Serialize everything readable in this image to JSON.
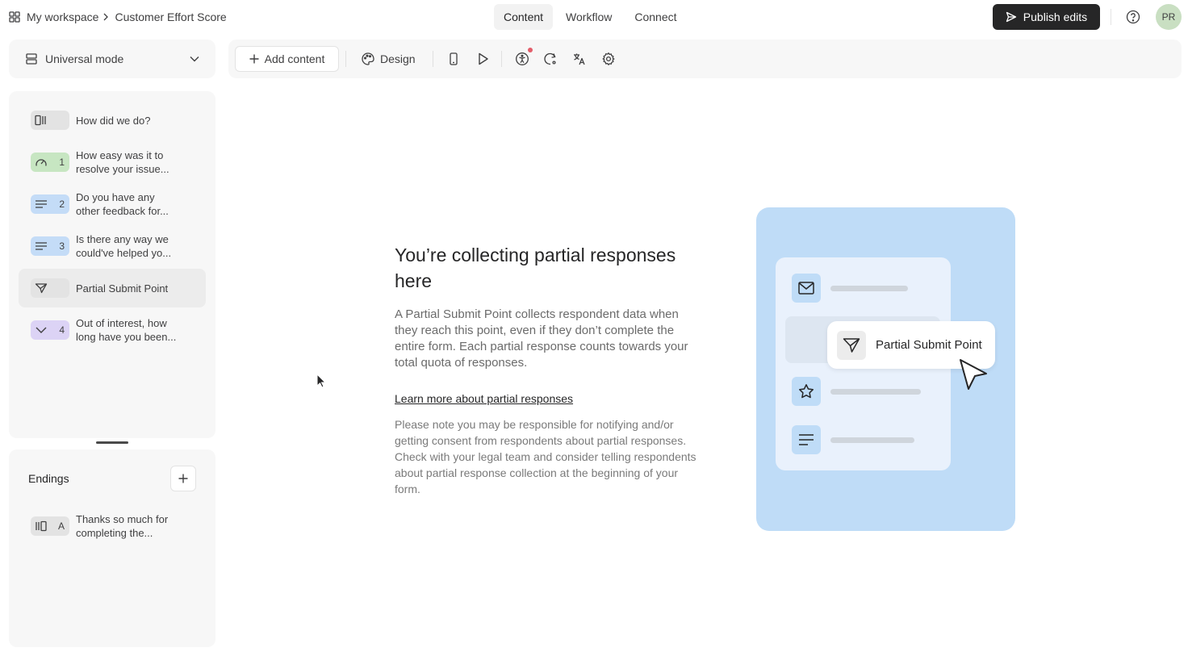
{
  "header": {
    "workspace": "My workspace",
    "form_title": "Customer Effort Score",
    "tabs": [
      {
        "label": "Content",
        "active": true
      },
      {
        "label": "Workflow",
        "active": false
      },
      {
        "label": "Connect",
        "active": false
      }
    ],
    "publish_label": "Publish edits",
    "avatar_initials": "PR"
  },
  "mode_selector": {
    "label": "Universal mode"
  },
  "toolbar": {
    "add_content_label": "Add content",
    "design_label": "Design",
    "icons": [
      "phone-preview-icon",
      "play-icon",
      "accessibility-icon",
      "logic-icon",
      "translate-icon",
      "settings-icon"
    ]
  },
  "questions": [
    {
      "number": "",
      "icon": "statement-icon",
      "color": "#e3e3e3",
      "line1": "How did we do?",
      "line2": ""
    },
    {
      "number": "1",
      "icon": "gauge-icon",
      "color": "#c7e6c2",
      "line1": "How easy was it to",
      "line2": "resolve your issue..."
    },
    {
      "number": "2",
      "icon": "text-lines-icon",
      "color": "#c4dcf7",
      "line1": "Do you have any",
      "line2": "other feedback for..."
    },
    {
      "number": "3",
      "icon": "text-lines-icon",
      "color": "#c4dcf7",
      "line1": "Is there any way we",
      "line2": "could've helped yo..."
    },
    {
      "number": "",
      "icon": "send-icon",
      "color": "#e3e3e3",
      "line1": "Partial Submit Point",
      "line2": ""
    },
    {
      "number": "4",
      "icon": "chevron-down-icon",
      "color": "#dcd3f5",
      "line1": "Out of interest, how",
      "line2": "long have you been..."
    }
  ],
  "endings": {
    "title": "Endings",
    "items": [
      {
        "letter": "A",
        "icon": "ending-icon",
        "color": "#e3e3e3",
        "line1": "Thanks so much for",
        "line2": "completing the..."
      }
    ]
  },
  "content": {
    "title_line1": "You’re collecting partial responses",
    "title_line2": "here",
    "description_lines": [
      "A Partial Submit Point collects respondent data when",
      "they reach this point, even if they don’t complete the",
      "entire form. Each partial response counts towards your",
      "total quota of responses."
    ],
    "learn_more": "Learn more about partial responses",
    "note_lines": [
      "Please note you may be responsible for notifying and/or",
      "getting consent from respondents about partial responses.",
      "Check with your legal team and consider telling respondents",
      "about partial response collection at the beginning of your",
      "form."
    ]
  },
  "illustration": {
    "popup_label": "Partial Submit Point",
    "background": "#bfdcf7"
  }
}
